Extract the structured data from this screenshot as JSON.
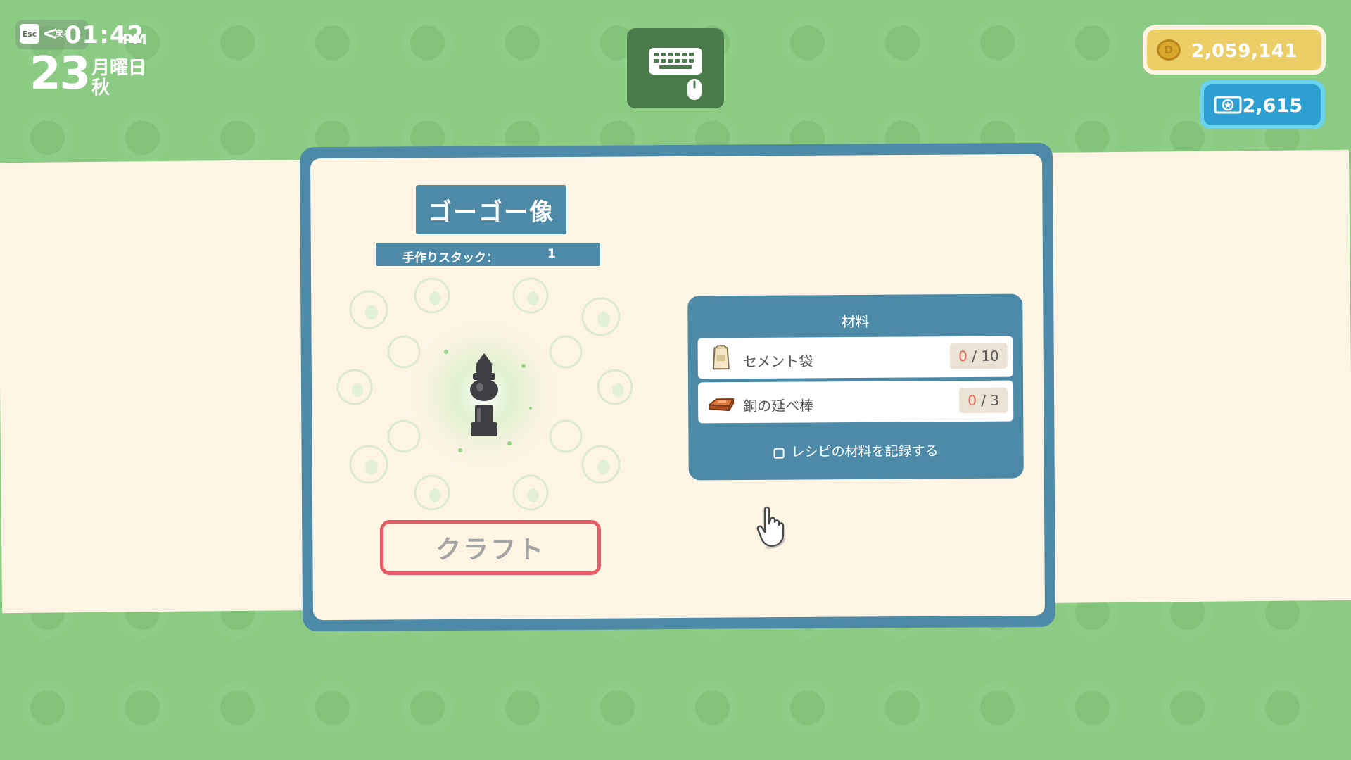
{
  "hud": {
    "esc_key": "Esc",
    "back_arrow": "<",
    "back_label": "戻る",
    "time": "01:42",
    "ampm": "PM",
    "day": "23",
    "weekday": "月曜日",
    "season": "秋"
  },
  "controls": {
    "icon": "keyboard-mouse-icon"
  },
  "currency": {
    "coins": "2,059,141",
    "coin_symbol": "D",
    "tickets": "2,615",
    "coin_color": "#ecce67",
    "ticket_color": "#2d9fd0"
  },
  "recipe": {
    "title": "ゴーゴー像",
    "stack_label": "手作りスタック：",
    "stack_value": "1",
    "craft_label": "クラフト"
  },
  "materials": {
    "title": "材料",
    "items": [
      {
        "name": "セメント袋",
        "have": "0",
        "need": "10",
        "icon": "cement-bag-icon"
      },
      {
        "name": "銅の延べ棒",
        "have": "0",
        "need": "3",
        "icon": "copper-bar-icon"
      }
    ],
    "separator": " / ",
    "record_label": "レシピの材料を記録する"
  },
  "colors": {
    "panel": "#4d8aa8",
    "background": "#8bcb84",
    "cream": "#fdf4e4",
    "craft_border": "#e75d65"
  }
}
